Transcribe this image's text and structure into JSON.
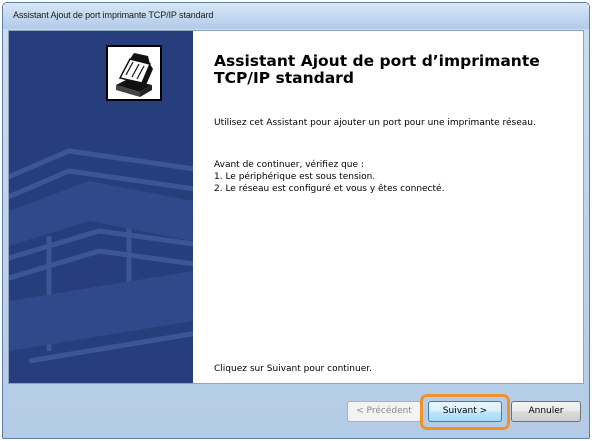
{
  "window": {
    "title": "Assistant Ajout de port imprimante TCP/IP standard"
  },
  "wizard": {
    "heading": "Assistant Ajout de port d’imprimante TCP/IP standard",
    "intro": "Utilisez cet Assistant pour ajouter un port pour une imprimante réseau.",
    "before_label": "Avant de continuer, vérifiez que :",
    "steps": [
      "1.  Le périphérique est sous tension.",
      "2.  Le réseau est configuré et vous y êtes connecté."
    ],
    "continue_hint": "Cliquez sur Suivant pour continuer."
  },
  "buttons": {
    "previous": "< Précédent",
    "next": "Suivant >",
    "cancel": "Annuler"
  },
  "colors": {
    "side_panel": "#263e7b",
    "highlight": "#f0922b"
  },
  "icons": {
    "wizard_icon": "printer-port-wizard-icon"
  }
}
